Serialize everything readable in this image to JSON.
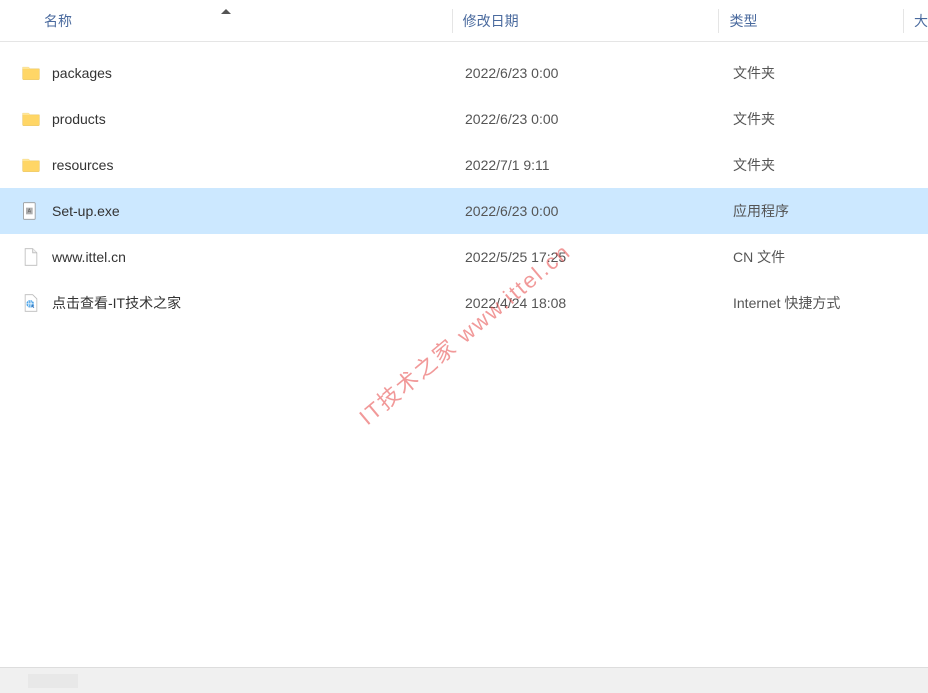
{
  "columns": {
    "name": "名称",
    "date": "修改日期",
    "type": "类型",
    "size": "大"
  },
  "files": [
    {
      "icon": "folder",
      "name": "packages",
      "date": "2022/6/23 0:00",
      "type": "文件夹",
      "selected": false
    },
    {
      "icon": "folder",
      "name": "products",
      "date": "2022/6/23 0:00",
      "type": "文件夹",
      "selected": false
    },
    {
      "icon": "folder",
      "name": "resources",
      "date": "2022/7/1 9:11",
      "type": "文件夹",
      "selected": false
    },
    {
      "icon": "exe",
      "name": "Set-up.exe",
      "date": "2022/6/23 0:00",
      "type": "应用程序",
      "selected": true
    },
    {
      "icon": "file",
      "name": "www.ittel.cn",
      "date": "2022/5/25 17:25",
      "type": "CN 文件",
      "selected": false
    },
    {
      "icon": "url",
      "name": "点击查看-IT技术之家",
      "date": "2022/4/24 18:08",
      "type": "Internet 快捷方式",
      "selected": false
    }
  ],
  "watermark": "IT技术之家 www.ittel.cn"
}
